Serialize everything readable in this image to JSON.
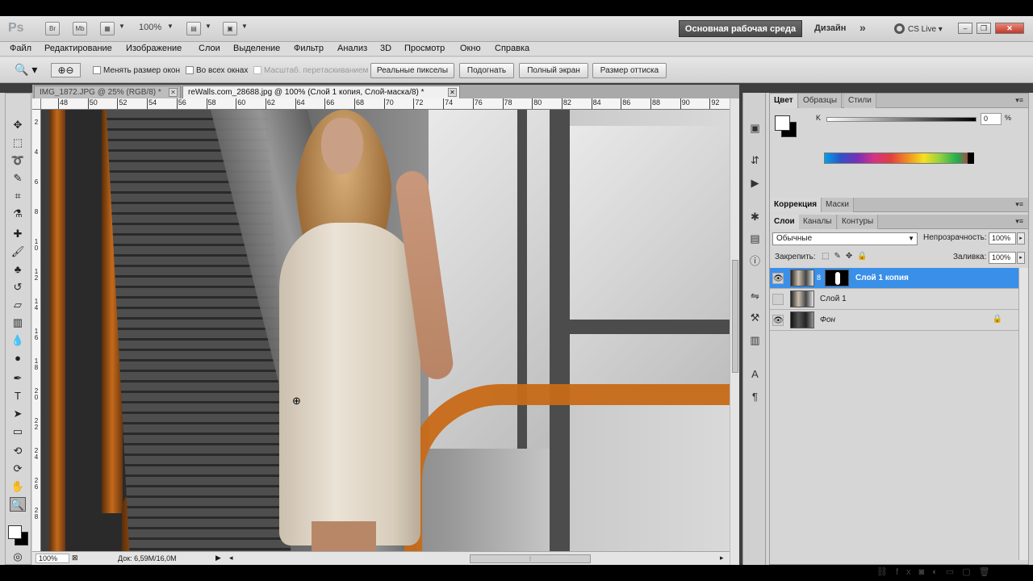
{
  "app": {
    "logo": "Ps",
    "bridge": "Br",
    "minibridge": "Mb",
    "zoom_value": "100%",
    "workspace_button": "Основная рабочая среда",
    "workspace_design": "Дизайн",
    "more": "»",
    "cslive": "CS Live"
  },
  "menu": [
    "Файл",
    "Редактирование",
    "Изображение",
    "Слои",
    "Выделение",
    "Фильтр",
    "Анализ",
    "3D",
    "Просмотр",
    "Окно",
    "Справка"
  ],
  "options": {
    "checks": [
      "Менять размер окон",
      "Во всех окнах",
      "Масштаб. перетаскиванием"
    ],
    "buttons": [
      "Реальные пикселы",
      "Подогнать",
      "Полный экран",
      "Размер оттиска"
    ]
  },
  "tabs": [
    {
      "label": "IMG_1872.JPG @ 25% (RGB/8) *",
      "active": false
    },
    {
      "label": "reWalls.com_28688.jpg @ 100% (Слой 1 копия, Слой-маска/8) *",
      "active": true
    }
  ],
  "ruler_h": [
    "48",
    "50",
    "52",
    "54",
    "56",
    "58",
    "60",
    "62",
    "64",
    "66",
    "68",
    "70",
    "72",
    "74",
    "76",
    "78",
    "80",
    "82",
    "84",
    "86",
    "88",
    "90",
    "92"
  ],
  "ruler_v": [
    "2",
    "4",
    "6",
    "8",
    "1\n0",
    "1\n2",
    "1\n4",
    "1\n6",
    "1\n8",
    "2\n0",
    "2\n2",
    "2\n4",
    "2\n6",
    "2\n8"
  ],
  "status": {
    "zoom": "100%",
    "doc": "Док: 6,59M/16,0M"
  },
  "color_panel": {
    "tabs": [
      "Цвет",
      "Образцы",
      "Стили"
    ],
    "k_label": "K",
    "k_value": "0",
    "pct": "%"
  },
  "adjust_panel": {
    "tabs": [
      "Коррекция",
      "Маски"
    ]
  },
  "layers_panel": {
    "tabs": [
      "Слои",
      "Каналы",
      "Контуры"
    ],
    "blend_mode": "Обычные",
    "opacity_label": "Непрозрачность:",
    "opacity_value": "100%",
    "lock_label": "Закрепить:",
    "fill_label": "Заливка:",
    "fill_value": "100%",
    "layers": [
      {
        "name": "Слой 1 копия",
        "visible": true,
        "active": true,
        "mask": true
      },
      {
        "name": "Слой 1",
        "visible": false,
        "active": false,
        "mask": false
      },
      {
        "name": "Фон",
        "visible": true,
        "active": false,
        "mask": false,
        "locked": true
      }
    ]
  },
  "colors": {
    "accent": "#3a8fe8",
    "workspace_bg": "#4a4a4a"
  }
}
